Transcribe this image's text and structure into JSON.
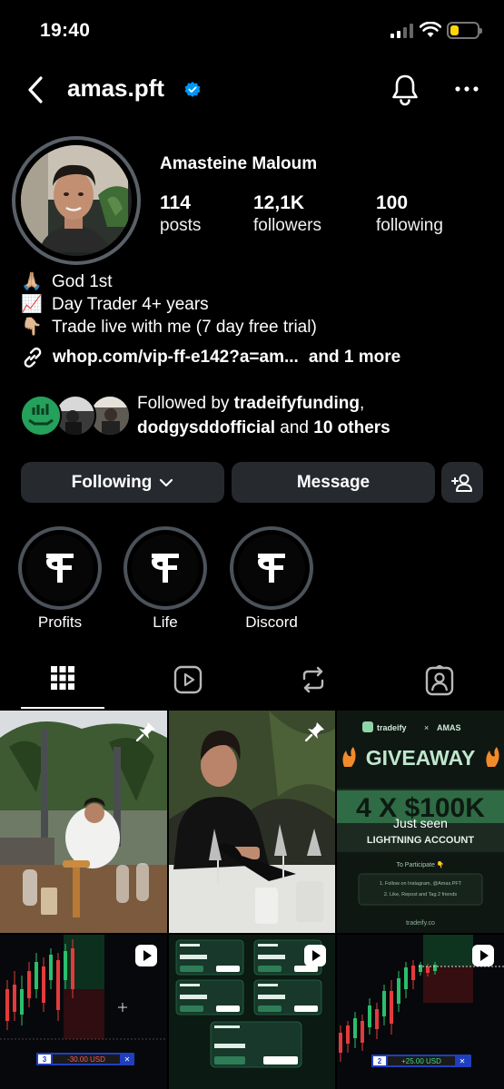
{
  "status": {
    "time": "19:40"
  },
  "header": {
    "username": "amas.pft"
  },
  "profile": {
    "full_name": "Amasteine Maloum",
    "stats": [
      {
        "value": "114",
        "label": "posts"
      },
      {
        "value": "12,1K",
        "label": "followers"
      },
      {
        "value": "100",
        "label": "following"
      }
    ],
    "bio": [
      {
        "emoji": "🙏🏼",
        "text": "God 1st"
      },
      {
        "emoji": "📈",
        "text": "Day Trader 4+ years"
      },
      {
        "emoji": "👇🏼",
        "text": "Trade live with me (7 day free trial)"
      }
    ],
    "link": "whop.com/vip-ff-e142?a=am...",
    "link_more": "and 1 more",
    "followed_by": {
      "prefix": "Followed by ",
      "user1": "tradeifyfunding",
      "sep": ",",
      "user2": "dodgysddofficial",
      "mid": " and ",
      "others": "10 others"
    }
  },
  "actions": {
    "following": "Following",
    "message": "Message"
  },
  "highlights": [
    {
      "label": "Profits"
    },
    {
      "label": "Life"
    },
    {
      "label": "Discord"
    }
  ],
  "tabs": [
    "grid-icon",
    "reels-icon",
    "reposts-icon",
    "tagged-icon"
  ],
  "posts": {
    "p3": {
      "brand": "tradeify",
      "x": "×",
      "partner": "AMAS",
      "headline": "GIVEAWAY",
      "amount": "4 X $100K",
      "just_seen": "Just seen",
      "account": "LIGHTNING ACCOUNT",
      "participate": "To Participate 👇",
      "step1": "1. Follow on Instagram, @Amas.PFT",
      "step2": "2. Like, Repost and Tag 2 friends",
      "footer": "tradeify.co"
    },
    "p4": {
      "num": "3",
      "pnl": "-30.00 USD",
      "x": "✕"
    },
    "p6": {
      "num": "2",
      "pnl": "+25.00 USD",
      "x": "✕"
    }
  },
  "colors": {
    "accent": "#0095f6",
    "background": "#000000",
    "button": "#26292e"
  }
}
